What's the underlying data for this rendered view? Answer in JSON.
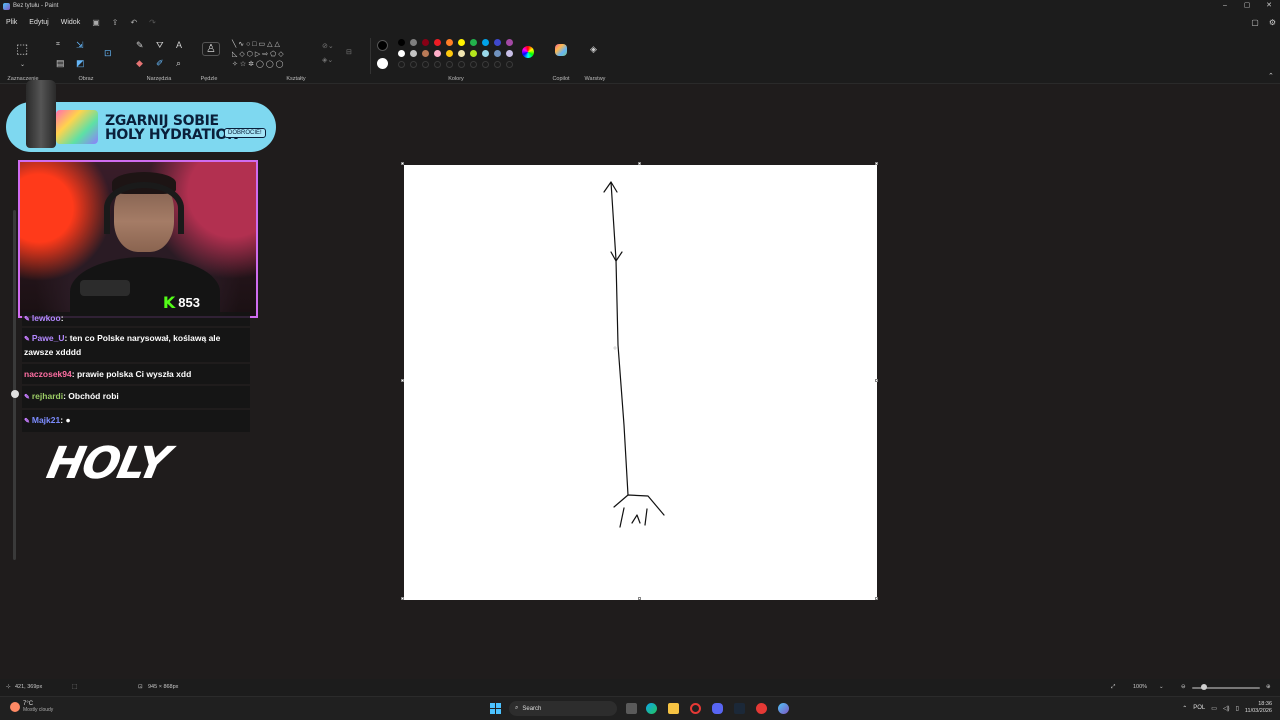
{
  "window": {
    "title": "Bez tytułu - Paint",
    "controls": [
      "–",
      "▢",
      "✕"
    ]
  },
  "menu": {
    "items": [
      "Plik",
      "Edytuj",
      "Widok"
    ],
    "quick_access": [
      "save-icon",
      "share-icon",
      "undo-icon",
      "redo-icon"
    ]
  },
  "ribbon": {
    "groups": {
      "selection": "Zaznaczenie",
      "image": "Obraz",
      "tools": "Narzędzia",
      "brushes": "Pędzle",
      "shapes": "Kształty",
      "colors": "Kolory",
      "copilot": "Copilot",
      "layers": "Warstwy"
    },
    "colors": {
      "primary": "#000000",
      "secondary": "#ffffff",
      "row1": [
        "#000000",
        "#7f7f7f",
        "#880015",
        "#ed1c24",
        "#ff7f27",
        "#fff200",
        "#22b14c",
        "#00a2e8",
        "#3f48cc",
        "#a349a4"
      ],
      "row2": [
        "#ffffff",
        "#c3c3c3",
        "#b97a57",
        "#ffaec9",
        "#ffc90e",
        "#efe4b0",
        "#b5e61d",
        "#99d9ea",
        "#7092be",
        "#c8bfe7"
      ]
    }
  },
  "overlay": {
    "banner": {
      "headline_line1": "ZGARNIJ SOBIE",
      "headline_line2": "HOLY HYDRATION",
      "bottle_text": "HOLY",
      "cta": "DOBROCIE!"
    },
    "webcam": {
      "platform_letter": "K",
      "viewer_count": "853"
    },
    "chat": [
      {
        "user": "lewkoo",
        "text": "",
        "color": "#b388ff"
      },
      {
        "user": "Pawe_U",
        "text": "ten co Polske narysował, koślawą ale zawsze xdddd",
        "color": "#b388ff"
      },
      {
        "user": "naczosek94",
        "text": "prawie polska Ci wyszła xdd",
        "color": "#ff6fa3"
      },
      {
        "user": "rejhardi",
        "text": "Obchód robi",
        "color": "#9ccc65"
      },
      {
        "user": "Majk21",
        "text": "",
        "color": "#7c8cff"
      }
    ],
    "logo": "HOLY"
  },
  "statusbar": {
    "cursor_position": "421, 369px",
    "canvas_size": "945 × 868px",
    "zoom": "100%"
  },
  "taskbar": {
    "weather_temp": "7°C",
    "weather_desc": "Mostly cloudy",
    "search_placeholder": "Search",
    "language": "POL",
    "time": "18:36",
    "date": "11/03/2026"
  }
}
